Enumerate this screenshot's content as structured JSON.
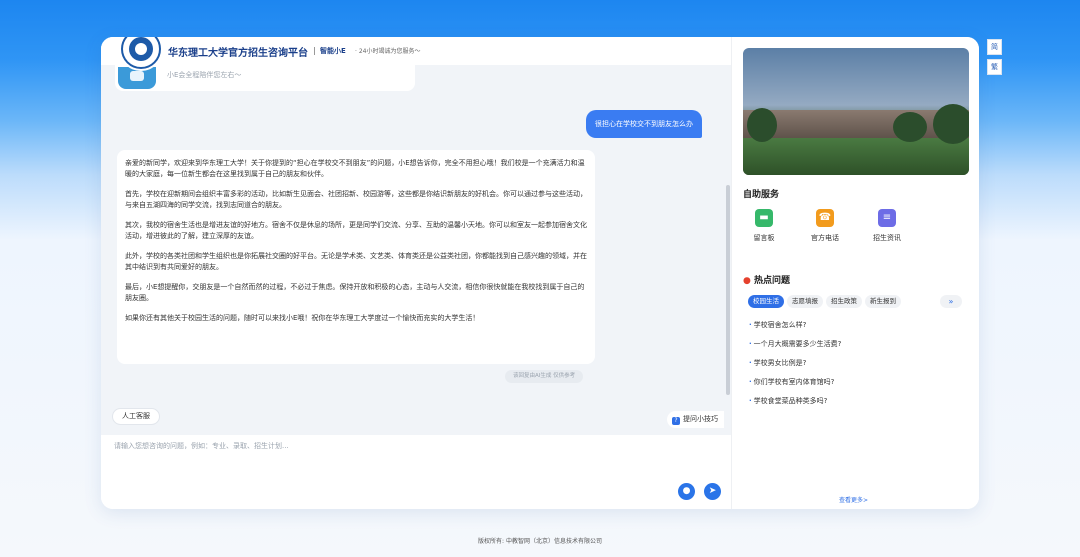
{
  "header": {
    "title": "华东理工大学官方招生咨询平台",
    "assistant": "智能小E",
    "tagline": "· 24小时竭诚为您服务～"
  },
  "chat": {
    "previous_snippet": "小E会全程陪伴您左右～",
    "user_message": "很担心在学校交不到朋友怎么办",
    "answer_paragraphs": [
      "亲爱的新同学，欢迎来到华东理工大学！关于你提到的“担心在学校交不到朋友”的问题，小E想告诉你，完全不用担心哦！我们校是一个充满活力和温暖的大家庭，每一位新生都会在这里找到属于自己的朋友和伙伴。",
      "首先，学校在迎新期间会组织丰富多彩的活动，比如新生见面会、社团招新、校园游等，这些都是你结识新朋友的好机会。你可以通过参与这些活动，与来自五湖四海的同学交流，找到志同道合的朋友。",
      "其次，我校的宿舍生活也是增进友谊的好地方。宿舍不仅是休息的场所，更是同学们交流、分享、互助的温馨小天地。你可以和室友一起参加宿舍文化活动，增进彼此的了解，建立深厚的友谊。",
      "此外，学校的各类社团和学生组织也是你拓展社交圈的好平台。无论是学术类、文艺类、体育类还是公益类社团，你都能找到自己感兴趣的领域，并在其中结识到有共同爱好的朋友。",
      "最后，小E想提醒你，交朋友是一个自然而然的过程，不必过于焦虑。保持开放和积极的心态，主动与人交流，相信你很快就能在我校找到属于自己的朋友圈。",
      "如果你还有其他关于校园生活的问题，随时可以来找小E哦！祝你在华东理工大学度过一个愉快而充实的大学生活！"
    ],
    "ai_note": "该回复由AI生成 仅供参考",
    "human_service": "人工客服",
    "tips": "提问小技巧",
    "input_placeholder": "请输入您想咨询的问题，例如：专业、录取、招生计划..."
  },
  "side": {
    "services_title": "自助服务",
    "services": [
      {
        "label": "留言板",
        "icon": "message-board-icon",
        "color": "#36b86a"
      },
      {
        "label": "官方电话",
        "icon": "phone-icon",
        "color": "#f29b1d"
      },
      {
        "label": "招生资讯",
        "icon": "news-icon",
        "color": "#6d6ce6"
      }
    ],
    "hot_title": "热点问题",
    "tabs": [
      "校园生活",
      "志愿填报",
      "招生政策",
      "新生报到"
    ],
    "questions": [
      "学校宿舍怎么样?",
      "一个月大概需要多少生活费?",
      "学校男女比例是?",
      "你们学校有室内体育馆吗?",
      "学校食堂菜品种类多吗?"
    ],
    "more": "查看更多>"
  },
  "lang": {
    "simplified": "简",
    "traditional": "繁"
  },
  "footer": "版权所有: 中教智网（北京）信息技术有限公司"
}
